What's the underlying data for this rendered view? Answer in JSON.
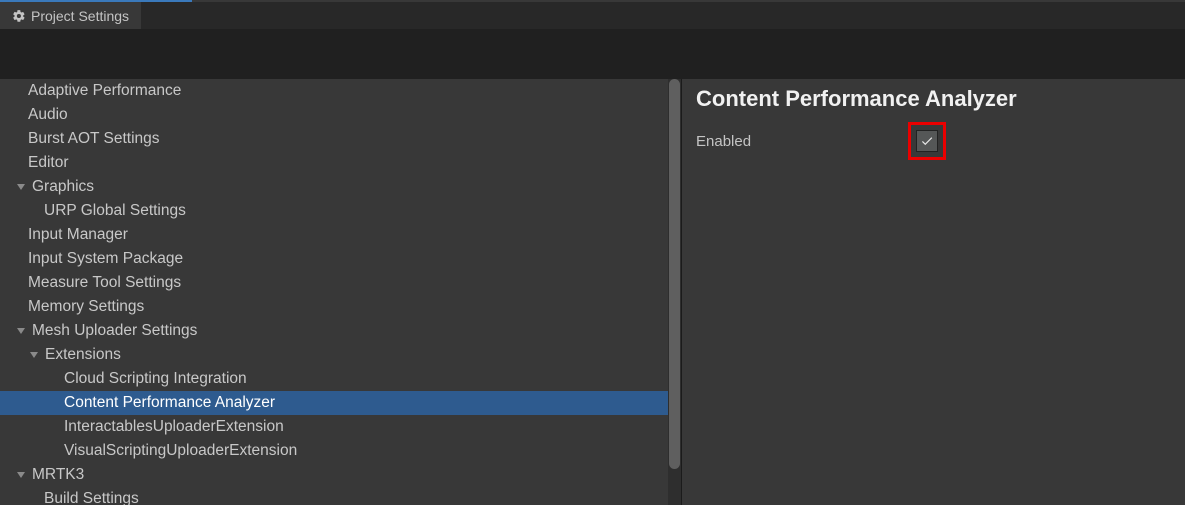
{
  "tab": {
    "title": "Project Settings"
  },
  "sidebar": {
    "items": [
      {
        "label": "Adaptive Performance",
        "indent": 0,
        "expandable": false,
        "selected": false
      },
      {
        "label": "Audio",
        "indent": 0,
        "expandable": false,
        "selected": false
      },
      {
        "label": "Burst AOT Settings",
        "indent": 0,
        "expandable": false,
        "selected": false
      },
      {
        "label": "Editor",
        "indent": 0,
        "expandable": false,
        "selected": false
      },
      {
        "label": "Graphics",
        "indent": 0,
        "expandable": true,
        "selected": false
      },
      {
        "label": "URP Global Settings",
        "indent": 1,
        "expandable": false,
        "selected": false
      },
      {
        "label": "Input Manager",
        "indent": 0,
        "expandable": false,
        "selected": false
      },
      {
        "label": "Input System Package",
        "indent": 0,
        "expandable": false,
        "selected": false
      },
      {
        "label": "Measure Tool Settings",
        "indent": 0,
        "expandable": false,
        "selected": false
      },
      {
        "label": "Memory Settings",
        "indent": 0,
        "expandable": false,
        "selected": false
      },
      {
        "label": "Mesh Uploader Settings",
        "indent": 0,
        "expandable": true,
        "selected": false
      },
      {
        "label": "Extensions",
        "indent": 1,
        "expandable": true,
        "selected": false
      },
      {
        "label": "Cloud Scripting Integration",
        "indent": 2,
        "expandable": false,
        "selected": false
      },
      {
        "label": "Content Performance Analyzer",
        "indent": 2,
        "expandable": false,
        "selected": true
      },
      {
        "label": "InteractablesUploaderExtension",
        "indent": 2,
        "expandable": false,
        "selected": false
      },
      {
        "label": "VisualScriptingUploaderExtension",
        "indent": 2,
        "expandable": false,
        "selected": false
      },
      {
        "label": "MRTK3",
        "indent": 0,
        "expandable": true,
        "selected": false
      },
      {
        "label": "Build Settings",
        "indent": 1,
        "expandable": false,
        "selected": false
      }
    ]
  },
  "content": {
    "title": "Content Performance Analyzer",
    "enabled_label": "Enabled",
    "enabled_checked": true
  },
  "colors": {
    "selected_row": "#2e5b8f",
    "highlight_red": "#eb0000",
    "tab_highlight": "#3a79bb"
  }
}
